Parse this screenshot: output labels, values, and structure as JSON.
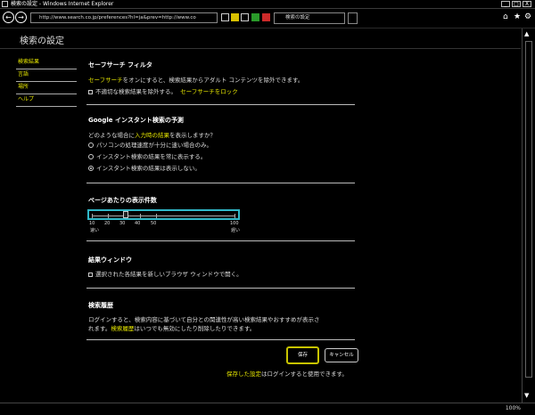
{
  "window": {
    "title": "検索の設定 - Windows Internet Explorer",
    "minimize": "_",
    "maximize": "□",
    "close": "X"
  },
  "browser": {
    "address": "http://www.search.co.jp/preferences?hl=ja&prev=http://www.co",
    "tab_label": "検索の設定",
    "tab_close": "x"
  },
  "page": {
    "title": "検索の設定",
    "sidebar": [
      {
        "label": "検索結果"
      },
      {
        "label": "言語"
      },
      {
        "label": "場所"
      },
      {
        "label": "ヘルプ"
      }
    ],
    "safesearch": {
      "title": "セーフサーチ フィルタ",
      "desc_link": "セーフサーチ",
      "desc_rest": "をオンにすると、検索結果からアダルト コンテンツを除外できます。",
      "checkbox_label": "不適切な検索結果を除外する。",
      "lock_link": "セーフサーチをロック"
    },
    "instant": {
      "title": "Google インスタント検索の予測",
      "question_pre": "どのような場合に",
      "question_link": "入力時の結果",
      "question_post": "を表示しますか？",
      "options": [
        {
          "label": "パソコンの処理速度が十分に速い場合のみ。",
          "selected": false
        },
        {
          "label": "インスタント検索の結果を常に表示する。",
          "selected": false
        },
        {
          "label": "インスタント検索の結果は表示しない。",
          "selected": true
        }
      ]
    },
    "per_page": {
      "title": "ページあたりの表示件数",
      "ticks": [
        "10",
        "20",
        "30",
        "40",
        "50",
        "100"
      ],
      "left_caption": "速い",
      "right_caption": "遅い",
      "value": 30
    },
    "results_window": {
      "title": "結果ウィンドウ",
      "checkbox_label": "選択された各結果を新しいブラウザ ウィンドウで開く。"
    },
    "history": {
      "title": "検索履歴",
      "line1": "ログインすると、検索内容に基づいて自分との関連性が高い検索結果やおすすめが表示さ",
      "line2_pre": "れます。",
      "line2_link": "検索履歴",
      "line2_post": "はいつでも無効にしたり削除したりできます。"
    },
    "save_label": "保存",
    "cancel_label": "キャンセル",
    "footnote_link": "保存した設定",
    "footnote_rest": "はログインすると使用できます。"
  },
  "status": {
    "zoom": "100%"
  }
}
